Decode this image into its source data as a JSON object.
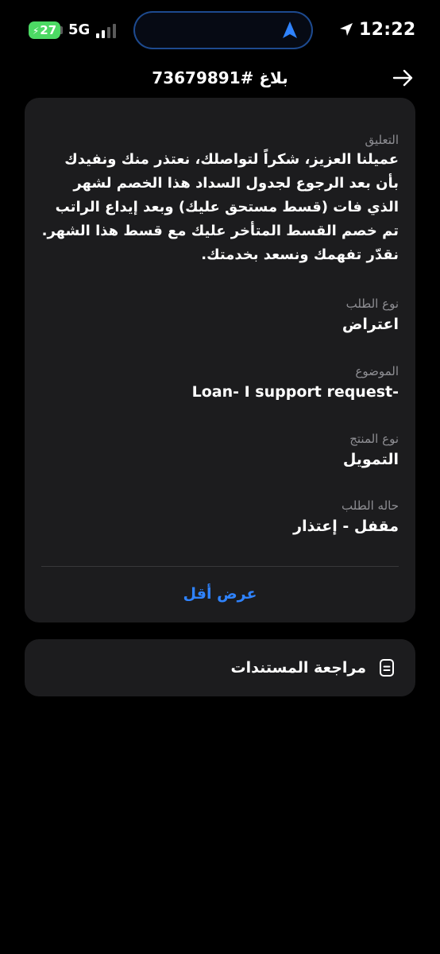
{
  "status_bar": {
    "battery": "27",
    "network": "5G",
    "time": "12:22",
    "colors": {
      "battery": "#4cd964",
      "signal_active": "#ffffff",
      "signal_inactive": "#5a5a5a",
      "island_accent": "#2f83ff"
    },
    "icons": [
      "charging-bolt-icon",
      "signal-bars-icon",
      "navigation-arrow-icon",
      "location-arrow-icon"
    ]
  },
  "header": {
    "title": "بلاغ #73679891",
    "back_icon": "arrow-right-icon"
  },
  "details": {
    "comment": {
      "label": "التعليق",
      "value": "عميلنا العزيز، شكراً لتواصلك، نعتذر منك ونفيدك\nبأن بعد الرجوع لجدول السداد  هذا الخصم لشهر\nالذي فات (قسط مستحق عليك) وبعد إيداع الراتب\nتم خصم القسط المتأخر عليك مع قسط هذا الشهر.\nنقدّر تفهمك ونسعد بخدمتك."
    },
    "request_type": {
      "label": "نوع الطلب",
      "value": "اعتراض"
    },
    "subject": {
      "label": "الموضوع",
      "value": "-Loan- I support request"
    },
    "product_type": {
      "label": "نوع المنتج",
      "value": "التمويل"
    },
    "request_status": {
      "label": "حاله الطلب",
      "value": "مقفل - إعتذار"
    },
    "show_less": "عرض أقل",
    "accent_color": "#2f83ff"
  },
  "documents": {
    "label": "مراجعة المستندات",
    "icon": "document-icon"
  }
}
